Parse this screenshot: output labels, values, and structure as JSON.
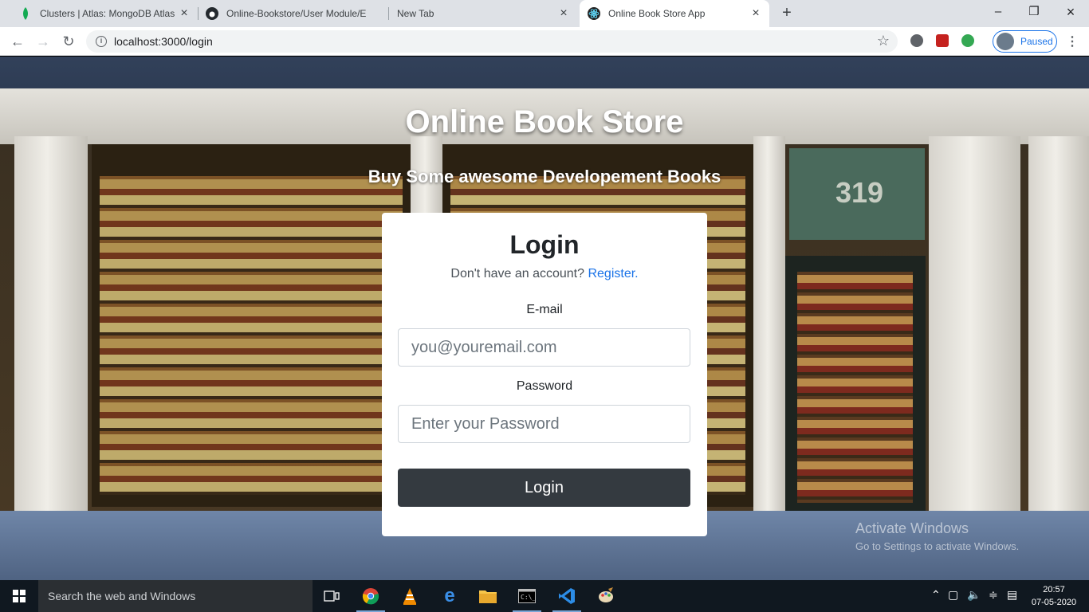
{
  "browser": {
    "tabs": [
      {
        "title": "Clusters | Atlas: MongoDB Atlas",
        "icon": "mongodb-leaf-icon",
        "active": false
      },
      {
        "title": "Online-Bookstore/User Module/E",
        "icon": "github-icon",
        "active": false
      },
      {
        "title": "New Tab",
        "icon": "",
        "active": false
      },
      {
        "title": "Online Book Store App",
        "icon": "react-icon",
        "active": true
      }
    ],
    "url": "localhost:3000/login",
    "profile_status": "Paused"
  },
  "page": {
    "title": "Online Book Store",
    "subtitle": "Buy Some awesome Developement Books",
    "login_card": {
      "heading": "Login",
      "prompt": "Don't have an account?",
      "register_link": "Register.",
      "email_label": "E-mail",
      "email_placeholder": "you@youremail.com",
      "password_label": "Password",
      "password_placeholder": "Enter your Password",
      "submit_label": "Login"
    },
    "watermark": {
      "line1": "Activate Windows",
      "line2": "Go to Settings to activate Windows."
    },
    "store_number": "319"
  },
  "taskbar": {
    "search_placeholder": "Search the web and Windows",
    "time": "20:57",
    "date": "07-05-2020"
  },
  "colors": {
    "accent": "#1a73e8",
    "login_button": "#343a40"
  }
}
